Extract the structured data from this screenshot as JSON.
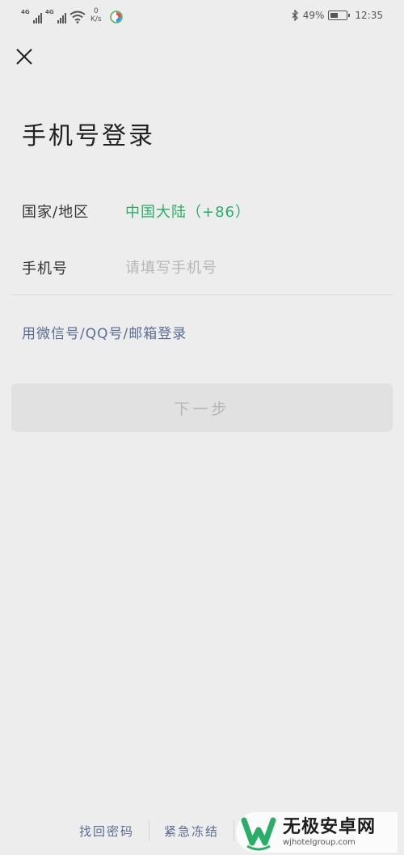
{
  "status_bar": {
    "network_1": "4G",
    "network_2": "4G",
    "speed_value": "0",
    "speed_unit": "K/s",
    "battery_percent": "49%",
    "battery_level": 0.49,
    "time": "12:35",
    "icons": [
      "signal-icon",
      "signal-icon",
      "wifi-icon",
      "app-notification-icon",
      "bluetooth-icon",
      "battery-icon"
    ]
  },
  "header": {
    "close_icon": "close-icon",
    "title": "手机号登录"
  },
  "form": {
    "region_label": "国家/地区",
    "region_value": "中国大陆（+86）",
    "phone_label": "手机号",
    "phone_value": "",
    "phone_placeholder": "请填写手机号"
  },
  "alt_login": "用微信号/QQ号/邮箱登录",
  "next_button": "下一步",
  "footer": {
    "links": [
      "找回密码",
      "紧急冻结"
    ]
  },
  "watermark": {
    "title": "无极安卓网",
    "url": "wjhotelgroup.com",
    "brand_color": "#2aae67"
  },
  "colors": {
    "background": "#ededed",
    "accent_green": "#2aae67",
    "link_blue": "#5a6d93",
    "button_disabled_bg": "#e1e1e1",
    "button_disabled_text": "#b5b5b5"
  }
}
